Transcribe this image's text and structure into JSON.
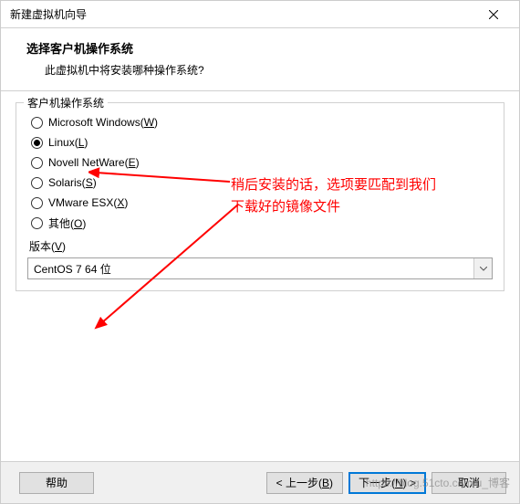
{
  "titlebar": {
    "title": "新建虚拟机向导"
  },
  "header": {
    "title": "选择客户机操作系统",
    "subtitle": "此虚拟机中将安装哪种操作系统?"
  },
  "os_group": {
    "legend": "客户机操作系统",
    "options": [
      {
        "label": "Microsoft Windows(",
        "hotkey": "W",
        "suffix": ")",
        "checked": false
      },
      {
        "label": "Linux(",
        "hotkey": "L",
        "suffix": ")",
        "checked": true
      },
      {
        "label": "Novell NetWare(",
        "hotkey": "E",
        "suffix": ")",
        "checked": false
      },
      {
        "label": "Solaris(",
        "hotkey": "S",
        "suffix": ")",
        "checked": false
      },
      {
        "label": "VMware ESX(",
        "hotkey": "X",
        "suffix": ")",
        "checked": false
      },
      {
        "label": "其他(",
        "hotkey": "O",
        "suffix": ")",
        "checked": false
      }
    ]
  },
  "version": {
    "label_prefix": "版本(",
    "label_hotkey": "V",
    "label_suffix": ")",
    "selected": "CentOS 7 64 位"
  },
  "annotation": {
    "line1": "稍后安装的话，选项要匹配到我们",
    "line2": "下载好的镜像文件",
    "color": "#ff0000"
  },
  "footer": {
    "help": "帮助",
    "back_prefix": "< 上一步(",
    "back_hotkey": "B",
    "back_suffix": ")",
    "next_prefix": "下一步(",
    "next_hotkey": "N",
    "next_suffix": ") >",
    "cancel": "取消"
  },
  "watermark": "https://blog.51cto.com/u_博客"
}
